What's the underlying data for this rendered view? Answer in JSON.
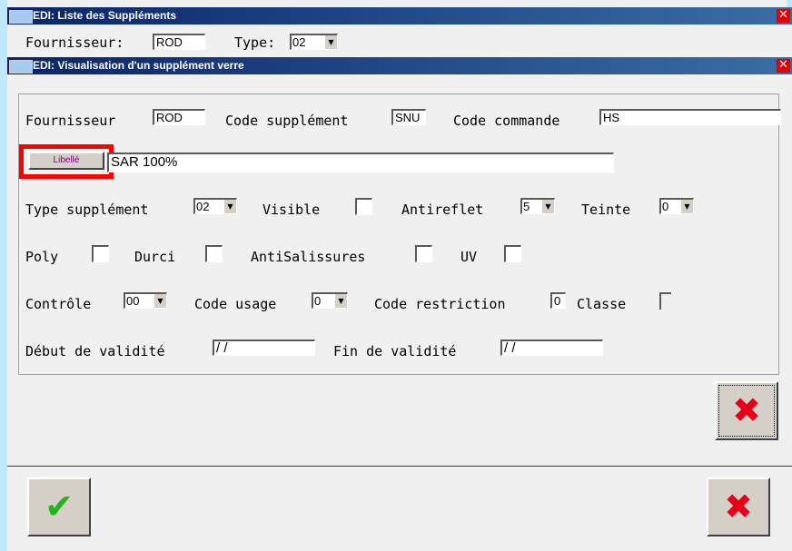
{
  "outer_window": {
    "title": "EDI: Liste des Suppléments",
    "fournisseur_label": "Fournisseur:",
    "fournisseur_value": "ROD",
    "type_label": "Type:",
    "type_value": "02"
  },
  "inner_window": {
    "title": "EDI: Visualisation d'un supplément verre",
    "fournisseur_label": "Fournisseur",
    "fournisseur_value": "ROD",
    "code_supplement_label": "Code supplément",
    "code_supplement_value": "SNU",
    "code_commande_label": "Code commande",
    "code_commande_value": "HS",
    "libelle_button": "Libellé",
    "libelle_value": "SAR 100%",
    "type_supplement_label": "Type supplément",
    "type_supplement_value": "02",
    "visible_label": "Visible",
    "antireflet_label": "Antireflet",
    "antireflet_value": "5",
    "teinte_label": "Teinte",
    "teinte_value": "0",
    "poly_label": "Poly",
    "durci_label": "Durci",
    "antisalissures_label": "AntiSalissures",
    "uv_label": "UV",
    "controle_label": "Contrôle",
    "controle_value": "00",
    "code_usage_label": "Code usage",
    "code_usage_value": "0",
    "code_restriction_label": "Code restriction",
    "code_restriction_value": "0",
    "classe_label": "Classe",
    "debut_validite_label": "Début de validité",
    "debut_validite_value": " /  /",
    "fin_validite_label": "Fin de validité",
    "fin_validite_value": " /  /"
  },
  "icons": {
    "close_x": "✖",
    "ok_check": "✔",
    "dropdown_arrow": "▼",
    "window_close": "✕"
  },
  "colors": {
    "highlight_box": "#ff0000",
    "cancel_icon": "#e8001a",
    "ok_icon": "#22b41e",
    "titlebar": "#0a246a"
  }
}
